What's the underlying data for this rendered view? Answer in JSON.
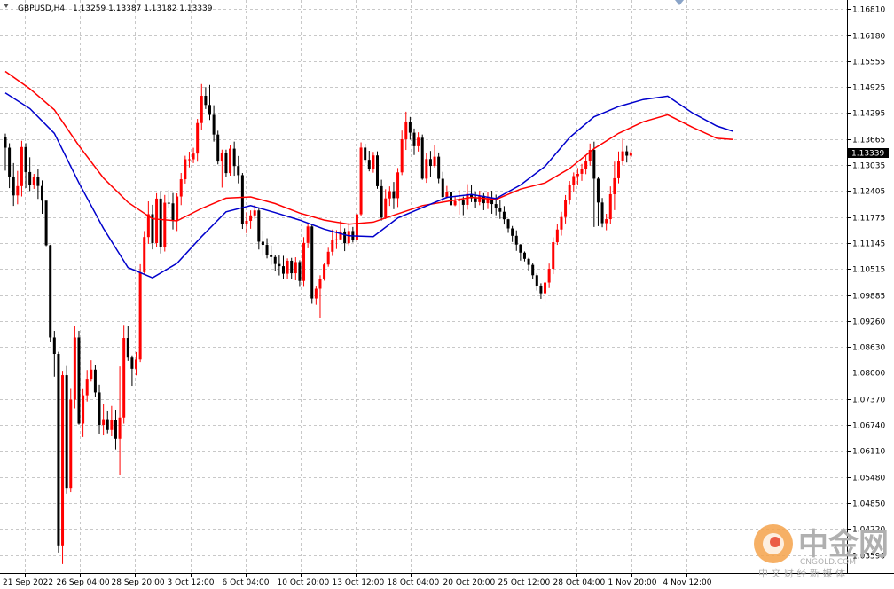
{
  "header": {
    "symbol": "GBPUSD,H4",
    "ohlc": "1.13259 1.13387 1.13182 1.13339"
  },
  "current_price_label": "1.13339",
  "watermark": {
    "name": "中金网",
    "url": "CNGOLD.COM",
    "sub": "中 文 财 经 新 媒 体"
  },
  "colors": {
    "bull": "#ff0000",
    "bear": "#000000",
    "ma_red": "#ff0000",
    "ma_blue": "#0000cc",
    "grid": "#c8c8c8",
    "price_line": "#808080",
    "price_tag_bg": "#000000",
    "price_tag_text": "#ffffff"
  },
  "chart_data": {
    "type": "candlestick",
    "ylim": [
      1.0315,
      1.1703
    ],
    "yticks": [
      "1.16810",
      "1.16180",
      "1.15555",
      "1.14925",
      "1.14295",
      "1.13665",
      "1.13035",
      "1.12405",
      "1.11775",
      "1.11145",
      "1.10515",
      "1.09885",
      "1.09260",
      "1.08630",
      "1.08000",
      "1.07370",
      "1.06740",
      "1.06110",
      "1.05480",
      "1.04850",
      "1.04220",
      "1.03590"
    ],
    "xticks": [
      "21 Sep 2022",
      "26 Sep 04:00",
      "28 Sep 20:00",
      "3 Oct 12:00",
      "6 Oct 04:00",
      "10 Oct 20:00",
      "13 Oct 12:00",
      "18 Oct 04:00",
      "20 Oct 20:00",
      "25 Oct 12:00",
      "28 Oct 04:00",
      "1 Nov 20:00",
      "4 Nov 12:00"
    ],
    "bar_count": 153,
    "last_price": 1.13339,
    "candles": [
      [
        1.137,
        1.13452,
        1.13793,
        1.12896
      ],
      [
        1.13452,
        1.12755,
        1.1356,
        1.12473
      ],
      [
        1.12755,
        1.12296,
        1.13079,
        1.12043
      ],
      [
        1.12296,
        1.12522,
        1.1289,
        1.12082
      ],
      [
        1.12522,
        1.13468,
        1.13619,
        1.12271
      ],
      [
        1.13468,
        1.12863,
        1.13562,
        1.12476
      ],
      [
        1.12863,
        1.12556,
        1.1322,
        1.12401
      ],
      [
        1.12556,
        1.12745,
        1.12818,
        1.12454
      ],
      [
        1.12745,
        1.12526,
        1.12936,
        1.12212
      ],
      [
        1.12526,
        1.1217,
        1.1266,
        1.11852
      ],
      [
        1.1217,
        1.1109,
        1.11288,
        1.11067
      ],
      [
        1.1109,
        1.08855,
        1.11102,
        1.08742
      ],
      [
        1.08855,
        1.08457,
        1.09015,
        1.07903
      ],
      [
        1.08457,
        1.0382,
        1.08509,
        1.03646
      ],
      [
        1.0382,
        1.0794,
        1.08045,
        1.03367
      ],
      [
        1.0794,
        1.05209,
        1.08165,
        1.05066
      ],
      [
        1.05209,
        1.0735,
        1.0763,
        1.05104
      ],
      [
        1.0735,
        1.08855,
        1.09142,
        1.07136
      ],
      [
        1.08855,
        1.0677,
        1.09016,
        1.06745
      ],
      [
        1.0677,
        1.07455,
        1.07624,
        1.0644
      ],
      [
        1.07455,
        1.07853,
        1.08066,
        1.07303
      ],
      [
        1.07853,
        1.08075,
        1.08304,
        1.07784
      ],
      [
        1.08075,
        1.07524,
        1.08185,
        1.07413
      ],
      [
        1.07524,
        1.06737,
        1.07709,
        1.06524
      ],
      [
        1.06737,
        1.06876,
        1.07244,
        1.06501
      ],
      [
        1.06876,
        1.06614,
        1.07083,
        1.06531
      ],
      [
        1.06614,
        1.06858,
        1.07195,
        1.06467
      ],
      [
        1.06858,
        1.06399,
        1.07103,
        1.06144
      ],
      [
        1.06399,
        1.06915,
        1.08153,
        1.05535
      ],
      [
        1.06915,
        1.08843,
        1.0916,
        1.0677
      ],
      [
        1.08843,
        1.08366,
        1.09137,
        1.08288
      ],
      [
        1.08366,
        1.08095,
        1.08419,
        1.07683
      ],
      [
        1.08095,
        1.08322,
        1.08502,
        1.07936
      ],
      [
        1.08322,
        1.10436,
        1.1063,
        1.08261
      ],
      [
        1.10436,
        1.11289,
        1.11434,
        1.10368
      ],
      [
        1.11289,
        1.11841,
        1.12153,
        1.11122
      ],
      [
        1.11841,
        1.11143,
        1.12069,
        1.10989
      ],
      [
        1.11143,
        1.12219,
        1.12349,
        1.11045
      ],
      [
        1.12219,
        1.11046,
        1.12394,
        1.10891
      ],
      [
        1.11046,
        1.12119,
        1.12307,
        1.10938
      ],
      [
        1.12119,
        1.12104,
        1.1243,
        1.11987
      ],
      [
        1.12104,
        1.11679,
        1.12354,
        1.11473
      ],
      [
        1.11679,
        1.1227,
        1.12346,
        1.11434
      ],
      [
        1.1227,
        1.12689,
        1.1284,
        1.12061
      ],
      [
        1.12689,
        1.13173,
        1.13257,
        1.12584
      ],
      [
        1.13173,
        1.13173,
        1.13355,
        1.12975
      ],
      [
        1.13173,
        1.1331,
        1.13451,
        1.13079
      ],
      [
        1.1331,
        1.1405,
        1.1415,
        1.13114
      ],
      [
        1.1405,
        1.14709,
        1.14994,
        1.13881
      ],
      [
        1.14709,
        1.14488,
        1.1492,
        1.1439
      ],
      [
        1.14488,
        1.14249,
        1.14974,
        1.14123
      ],
      [
        1.14249,
        1.13771,
        1.14481,
        1.136
      ],
      [
        1.13771,
        1.13118,
        1.13864,
        1.13049
      ],
      [
        1.13118,
        1.13318,
        1.13405,
        1.12486
      ],
      [
        1.13318,
        1.12838,
        1.13404,
        1.12735
      ],
      [
        1.12838,
        1.13429,
        1.13525,
        1.12776
      ],
      [
        1.13429,
        1.13008,
        1.136,
        1.12774
      ],
      [
        1.13008,
        1.12788,
        1.13252,
        1.1259
      ],
      [
        1.12788,
        1.11615,
        1.1284,
        1.11486
      ],
      [
        1.11615,
        1.11681,
        1.11892,
        1.11377
      ],
      [
        1.11681,
        1.11813,
        1.11933,
        1.1149
      ],
      [
        1.11813,
        1.11932,
        1.12068,
        1.11734
      ],
      [
        1.11932,
        1.11176,
        1.12002,
        1.10987
      ],
      [
        1.11176,
        1.11099,
        1.11451,
        1.10832
      ],
      [
        1.11099,
        1.10848,
        1.1126,
        1.10771
      ],
      [
        1.10848,
        1.10804,
        1.11084,
        1.10615
      ],
      [
        1.10804,
        1.10635,
        1.10859,
        1.10466
      ],
      [
        1.10635,
        1.10582,
        1.10841,
        1.10357
      ],
      [
        1.10582,
        1.10399,
        1.10833,
        1.10269
      ],
      [
        1.10399,
        1.10714,
        1.10771,
        1.10277
      ],
      [
        1.10714,
        1.10411,
        1.10783,
        1.10275
      ],
      [
        1.10411,
        1.10682,
        1.10798,
        1.1024
      ],
      [
        1.10682,
        1.10225,
        1.10725,
        1.10101
      ],
      [
        1.10225,
        1.11146,
        1.11287,
        1.10103
      ],
      [
        1.11146,
        1.11544,
        1.1162,
        1.11016
      ],
      [
        1.11544,
        1.09799,
        1.11595,
        1.09671
      ],
      [
        1.09799,
        1.10036,
        1.1011,
        1.09646
      ],
      [
        1.10036,
        1.10269,
        1.10363,
        1.09324
      ],
      [
        1.10269,
        1.10622,
        1.10654,
        1.10231
      ],
      [
        1.10622,
        1.10932,
        1.11029,
        1.10569
      ],
      [
        1.10932,
        1.11216,
        1.1147,
        1.1083
      ],
      [
        1.11216,
        1.11233,
        1.11456,
        1.10999
      ],
      [
        1.11233,
        1.11424,
        1.11684,
        1.11212
      ],
      [
        1.11424,
        1.11139,
        1.115,
        1.10948
      ],
      [
        1.11139,
        1.11435,
        1.11628,
        1.11086
      ],
      [
        1.11435,
        1.11223,
        1.11533,
        1.11156
      ],
      [
        1.11223,
        1.11839,
        1.12012,
        1.11106
      ],
      [
        1.11839,
        1.13454,
        1.13581,
        1.11799
      ],
      [
        1.13454,
        1.13159,
        1.13548,
        1.13082
      ],
      [
        1.13159,
        1.12926,
        1.13377,
        1.1288
      ],
      [
        1.12926,
        1.13265,
        1.13351,
        1.12847
      ],
      [
        1.13265,
        1.1252,
        1.13364,
        1.12457
      ],
      [
        1.1252,
        1.1176,
        1.12677,
        1.11687
      ],
      [
        1.1176,
        1.12224,
        1.12446,
        1.11724
      ],
      [
        1.12224,
        1.12397,
        1.12515,
        1.12042
      ],
      [
        1.12397,
        1.1223,
        1.12623,
        1.11963
      ],
      [
        1.1223,
        1.12855,
        1.12961,
        1.12015
      ],
      [
        1.12855,
        1.13657,
        1.13868,
        1.12789
      ],
      [
        1.13657,
        1.14087,
        1.14325,
        1.13398
      ],
      [
        1.14087,
        1.13816,
        1.14198,
        1.13649
      ],
      [
        1.13816,
        1.13488,
        1.13917,
        1.13276
      ],
      [
        1.13488,
        1.13693,
        1.13825,
        1.13359
      ],
      [
        1.13693,
        1.12703,
        1.13772,
        1.12676
      ],
      [
        1.12703,
        1.13178,
        1.13334,
        1.12602
      ],
      [
        1.13178,
        1.13011,
        1.13373,
        1.12736
      ],
      [
        1.13011,
        1.13235,
        1.13526,
        1.1297
      ],
      [
        1.13235,
        1.127,
        1.13336,
        1.12593
      ],
      [
        1.127,
        1.12258,
        1.12868,
        1.12149
      ],
      [
        1.12258,
        1.1238,
        1.12526,
        1.12225
      ],
      [
        1.1238,
        1.12059,
        1.12447,
        1.11967
      ],
      [
        1.12059,
        1.1216,
        1.12283,
        1.12037
      ],
      [
        1.1216,
        1.12189,
        1.12426,
        1.11834
      ],
      [
        1.12189,
        1.12068,
        1.12269,
        1.11818
      ],
      [
        1.12068,
        1.1233,
        1.12569,
        1.11951
      ],
      [
        1.1233,
        1.12226,
        1.12545,
        1.12133
      ],
      [
        1.12226,
        1.12134,
        1.12367,
        1.11982
      ],
      [
        1.12134,
        1.12287,
        1.12406,
        1.12059
      ],
      [
        1.12287,
        1.12108,
        1.1235,
        1.11939
      ],
      [
        1.12108,
        1.12214,
        1.12376,
        1.11967
      ],
      [
        1.12214,
        1.12087,
        1.1241,
        1.11853
      ],
      [
        1.12087,
        1.12001,
        1.12315,
        1.11816
      ],
      [
        1.12001,
        1.11901,
        1.12175,
        1.11728
      ],
      [
        1.11901,
        1.11719,
        1.12038,
        1.11592
      ],
      [
        1.11719,
        1.11497,
        1.11728,
        1.1139
      ],
      [
        1.11497,
        1.11319,
        1.11556,
        1.11169
      ],
      [
        1.11319,
        1.11106,
        1.1145,
        1.10954
      ],
      [
        1.11106,
        1.10911,
        1.1112,
        1.10718
      ],
      [
        1.10911,
        1.1076,
        1.1094,
        1.10698
      ],
      [
        1.1076,
        1.10614,
        1.10785,
        1.10473
      ],
      [
        1.10614,
        1.10363,
        1.10655,
        1.1028
      ],
      [
        1.10363,
        1.10112,
        1.10409,
        1.09991
      ],
      [
        1.10112,
        1.09926,
        1.10168,
        1.0979
      ],
      [
        1.09926,
        1.10186,
        1.10219,
        1.09715
      ],
      [
        1.10186,
        1.10519,
        1.10645,
        1.10052
      ],
      [
        1.10519,
        1.11163,
        1.11283,
        1.10389
      ],
      [
        1.11163,
        1.11471,
        1.11607,
        1.11099
      ],
      [
        1.11471,
        1.11773,
        1.119,
        1.11324
      ],
      [
        1.11773,
        1.12185,
        1.12305,
        1.11617
      ],
      [
        1.12185,
        1.12551,
        1.12647,
        1.12079
      ],
      [
        1.12551,
        1.12765,
        1.12853,
        1.12385
      ],
      [
        1.12765,
        1.12821,
        1.12961,
        1.12543
      ],
      [
        1.12821,
        1.1294,
        1.1306,
        1.1265
      ],
      [
        1.1294,
        1.13136,
        1.13264,
        1.12812
      ],
      [
        1.13136,
        1.13398,
        1.13553,
        1.13015
      ],
      [
        1.13398,
        1.12702,
        1.13599,
        1.11532
      ],
      [
        1.12702,
        1.12124,
        1.12755,
        1.11553
      ],
      [
        1.12124,
        1.11625,
        1.12234,
        1.11525
      ],
      [
        1.11625,
        1.11722,
        1.11852,
        1.11453
      ],
      [
        1.11722,
        1.12325,
        1.12515,
        1.11595
      ],
      [
        1.12325,
        1.12713,
        1.13115,
        1.1194
      ],
      [
        1.12713,
        1.13138,
        1.13362,
        1.12591
      ],
      [
        1.13138,
        1.13365,
        1.1367,
        1.13022
      ],
      [
        1.13365,
        1.13259,
        1.13493,
        1.13094
      ],
      [
        1.13259,
        1.13339,
        1.13387,
        1.13182
      ]
    ],
    "ma_red": [
      [
        0,
        1.153
      ],
      [
        6,
        1.1488
      ],
      [
        12,
        1.1437
      ],
      [
        18,
        1.135
      ],
      [
        24,
        1.1272
      ],
      [
        30,
        1.1213
      ],
      [
        36,
        1.1173
      ],
      [
        42,
        1.1168
      ],
      [
        48,
        1.1198
      ],
      [
        54,
        1.1223
      ],
      [
        60,
        1.1226
      ],
      [
        66,
        1.121
      ],
      [
        72,
        1.1187
      ],
      [
        78,
        1.117
      ],
      [
        84,
        1.116
      ],
      [
        90,
        1.1165
      ],
      [
        96,
        1.1185
      ],
      [
        102,
        1.1205
      ],
      [
        108,
        1.1215
      ],
      [
        114,
        1.1225
      ],
      [
        120,
        1.122
      ],
      [
        126,
        1.1245
      ],
      [
        132,
        1.126
      ],
      [
        138,
        1.1295
      ],
      [
        144,
        1.1343
      ],
      [
        150,
        1.138
      ],
      [
        156,
        1.1408
      ],
      [
        162,
        1.1425
      ],
      [
        168,
        1.1395
      ],
      [
        174,
        1.1368
      ],
      [
        178,
        1.1365
      ]
    ],
    "ma_blue": [
      [
        0,
        1.1478
      ],
      [
        6,
        1.144
      ],
      [
        12,
        1.138
      ],
      [
        18,
        1.126
      ],
      [
        24,
        1.115
      ],
      [
        30,
        1.1055
      ],
      [
        36,
        1.103
      ],
      [
        42,
        1.1065
      ],
      [
        48,
        1.113
      ],
      [
        54,
        1.119
      ],
      [
        60,
        1.1205
      ],
      [
        66,
        1.1188
      ],
      [
        72,
        1.117
      ],
      [
        78,
        1.1148
      ],
      [
        84,
        1.1132
      ],
      [
        90,
        1.113
      ],
      [
        96,
        1.1175
      ],
      [
        102,
        1.12
      ],
      [
        108,
        1.1225
      ],
      [
        114,
        1.1232
      ],
      [
        120,
        1.1222
      ],
      [
        126,
        1.1255
      ],
      [
        132,
        1.13
      ],
      [
        138,
        1.137
      ],
      [
        144,
        1.142
      ],
      [
        150,
        1.1445
      ],
      [
        156,
        1.1462
      ],
      [
        162,
        1.147
      ],
      [
        168,
        1.143
      ],
      [
        174,
        1.1398
      ],
      [
        178,
        1.1385
      ]
    ]
  }
}
